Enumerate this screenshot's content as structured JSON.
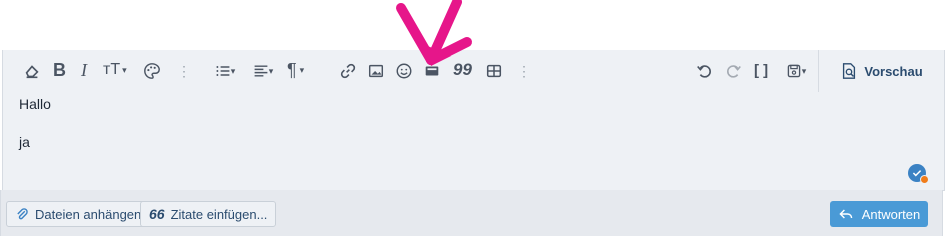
{
  "editor": {
    "toolbar": {
      "items": [
        {
          "icon": "eraser-icon"
        },
        {
          "icon": "bold-icon",
          "glyph": "B"
        },
        {
          "icon": "italic-icon",
          "glyph": "I"
        },
        {
          "icon": "text-size-icon",
          "glyph": "тT"
        },
        {
          "icon": "palette-icon"
        },
        {
          "icon": "more-vertical-icon"
        },
        {
          "icon": "list-icon"
        },
        {
          "icon": "align-icon"
        },
        {
          "icon": "paragraph-icon",
          "glyph": "¶"
        },
        {
          "icon": "link-icon"
        },
        {
          "icon": "image-icon"
        },
        {
          "icon": "smiley-icon"
        },
        {
          "icon": "media-icon"
        },
        {
          "icon": "quote-icon",
          "glyph": "99"
        },
        {
          "icon": "table-icon"
        },
        {
          "icon": "more-vertical-icon"
        },
        {
          "icon": "undo-icon"
        },
        {
          "icon": "redo-icon"
        },
        {
          "icon": "bbcode-icon",
          "glyph": "[ ]"
        },
        {
          "icon": "drafts-icon"
        }
      ],
      "preview_label": "Vorschau"
    },
    "content": {
      "lines": [
        "Hallo",
        "ja"
      ]
    }
  },
  "footer": {
    "attach_label": "Dateien anhängen",
    "quotes_label": "Zitate einfügen...",
    "reply_label": "Antworten"
  },
  "colors": {
    "accent": "#4a9ad6",
    "annotation_arrow": "#e6168a"
  }
}
